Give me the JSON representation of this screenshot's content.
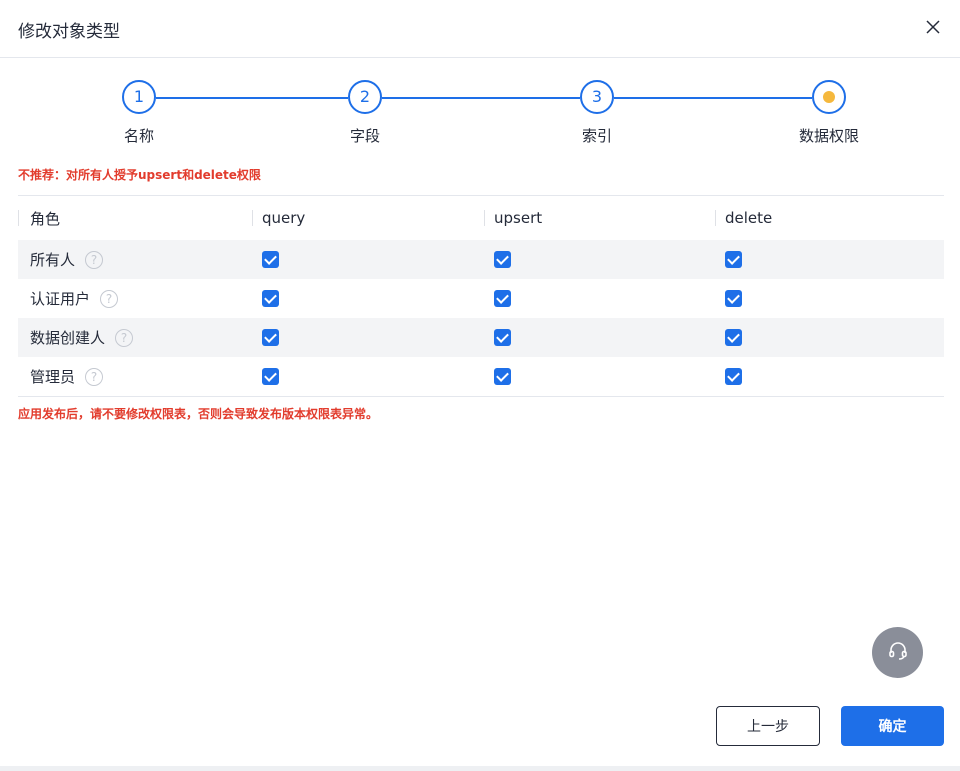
{
  "dialog": {
    "title": "修改对象类型"
  },
  "steps": [
    {
      "number": "1",
      "label": "名称",
      "state": "done"
    },
    {
      "number": "2",
      "label": "字段",
      "state": "done"
    },
    {
      "number": "3",
      "label": "索引",
      "state": "done"
    },
    {
      "number": "",
      "label": "数据权限",
      "state": "current"
    }
  ],
  "warning_top": "不推荐：对所有人授予upsert和delete权限",
  "table": {
    "headers": [
      "角色",
      "query",
      "upsert",
      "delete"
    ],
    "rows": [
      {
        "role": "所有人",
        "query": true,
        "upsert": true,
        "delete": true
      },
      {
        "role": "认证用户",
        "query": true,
        "upsert": true,
        "delete": true
      },
      {
        "role": "数据创建人",
        "query": true,
        "upsert": true,
        "delete": true
      },
      {
        "role": "管理员",
        "query": true,
        "upsert": true,
        "delete": true
      }
    ],
    "help_glyph": "?"
  },
  "warning_bottom": "应用发布后，请不要修改权限表，否则会导致发布版本权限表异常。",
  "footer": {
    "prev_label": "上一步",
    "ok_label": "确定"
  },
  "colors": {
    "primary": "#1e6fe8",
    "warning": "#e23c2d",
    "current_step_dot": "#f5b83d"
  },
  "icons": {
    "close": "close-icon",
    "help": "question-circle-icon",
    "support": "headset-icon"
  }
}
